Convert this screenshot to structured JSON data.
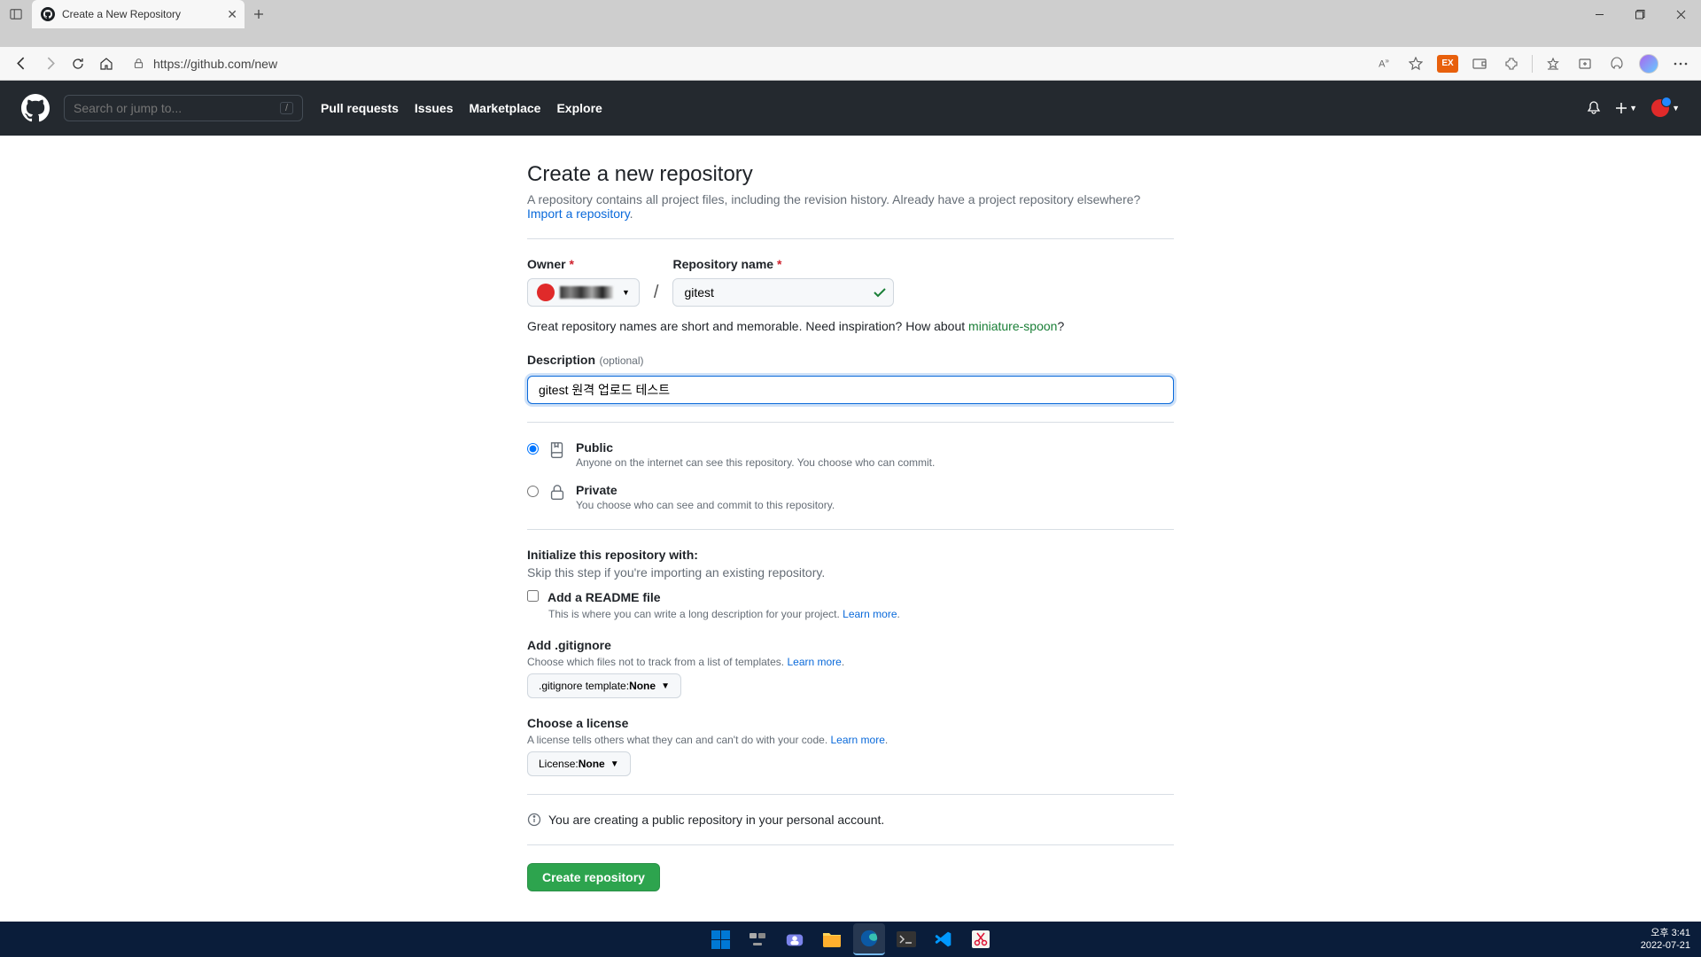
{
  "browser": {
    "tab_title": "Create a New Repository",
    "url": "https://github.com/new"
  },
  "gh_header": {
    "search_placeholder": "Search or jump to...",
    "nav": {
      "pulls": "Pull requests",
      "issues": "Issues",
      "marketplace": "Marketplace",
      "explore": "Explore"
    }
  },
  "page": {
    "title": "Create a new repository",
    "subtitle1": "A repository contains all project files, including the revision history. Already have a project repository elsewhere?",
    "import_link": "Import a repository",
    "owner_label": "Owner",
    "reponame_label": "Repository name",
    "reponame_value": "gitest",
    "suggestion_pre": "Great repository names are short and memorable. Need inspiration? How about ",
    "suggestion_name": "miniature-spoon",
    "suggestion_q": "?",
    "desc_label": "Description",
    "optional_text": "(optional)",
    "desc_value": "gitest 원격 업로드 테스트",
    "public_title": "Public",
    "public_desc": "Anyone on the internet can see this repository. You choose who can commit.",
    "private_title": "Private",
    "private_desc": "You choose who can see and commit to this repository.",
    "init_title": "Initialize this repository with:",
    "init_sub": "Skip this step if you're importing an existing repository.",
    "readme_label": "Add a README file",
    "readme_sub_pre": "This is where you can write a long description for your project. ",
    "learn_more": "Learn more",
    "gitignore_title": "Add .gitignore",
    "gitignore_sub_pre": "Choose which files not to track from a list of templates. ",
    "gitignore_btn_pre": ".gitignore template: ",
    "gitignore_btn_val": "None",
    "license_title": "Choose a license",
    "license_sub_pre": "A license tells others what they can and can't do with your code. ",
    "license_btn_pre": "License: ",
    "license_btn_val": "None",
    "info_text": "You are creating a public repository in your personal account.",
    "create_btn": "Create repository"
  },
  "taskbar": {
    "time": "오후 3:41",
    "date": "2022-07-21"
  }
}
